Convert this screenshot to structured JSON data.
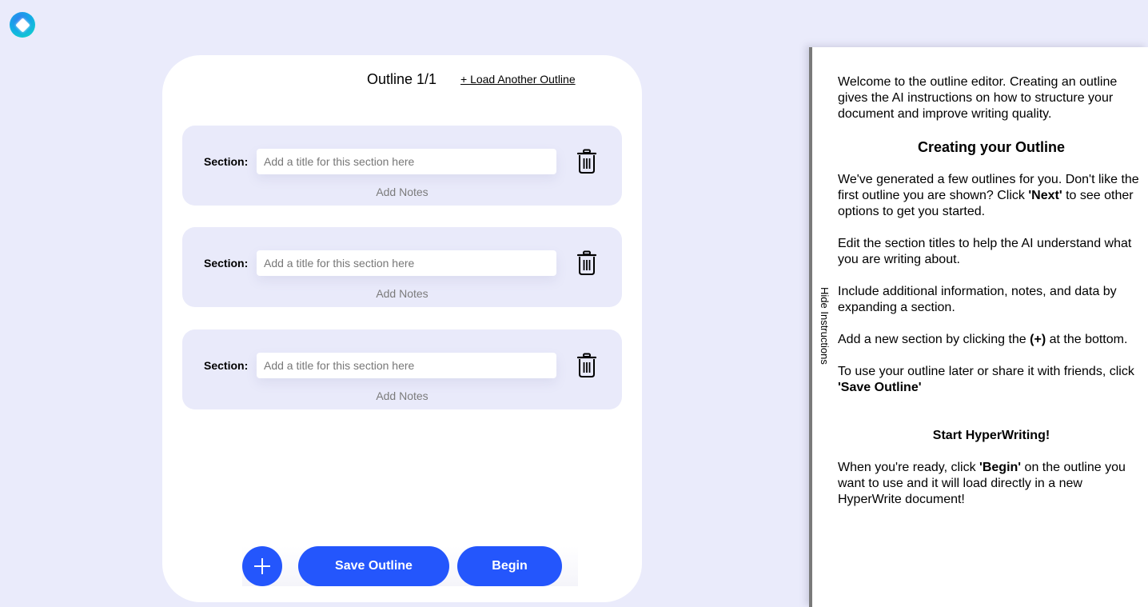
{
  "app": {
    "logo_icon": "hyperwrite-logo-icon"
  },
  "outline": {
    "counter_label": "Outline 1/1",
    "load_another_label": "+ Load Another Outline",
    "sections": [
      {
        "label": "Section:",
        "value": "",
        "placeholder": "Add a title for this section here",
        "notes_label": "Add Notes"
      },
      {
        "label": "Section:",
        "value": "",
        "placeholder": "Add a title for this section here",
        "notes_label": "Add Notes"
      },
      {
        "label": "Section:",
        "value": "",
        "placeholder": "Add a title for this section here",
        "notes_label": "Add Notes"
      }
    ],
    "add_section_icon": "plus-icon",
    "save_label": "Save Outline",
    "begin_label": "Begin",
    "accent_color": "#2456fc"
  },
  "instructions": {
    "hide_label": "Hide Instructions",
    "intro": "Welcome to the outline editor. Creating an outline gives the AI instructions on how to structure your document and improve writing quality.",
    "heading_create": "Creating your Outline",
    "p1_a": "We've generated a few outlines for you. Don't like the first outline you are shown? Click ",
    "p1_b": "'Next'",
    "p1_c": " to see other options to get you started.",
    "p2": "Edit the section titles to help the AI understand what you are writing about.",
    "p3": "Include additional information, notes, and data by expanding a section.",
    "p4_a": "Add a new section by clicking the ",
    "p4_b": "(+)",
    "p4_c": " at the bottom.",
    "p5_a": "To use your outline later or share it with friends, click ",
    "p5_b": "'Save Outline'",
    "heading_start": "Start HyperWriting!",
    "p6_a": "When you're ready, click ",
    "p6_b": "'Begin'",
    "p6_c": " on the outline you want to use and it will load directly in a new HyperWrite document!"
  }
}
